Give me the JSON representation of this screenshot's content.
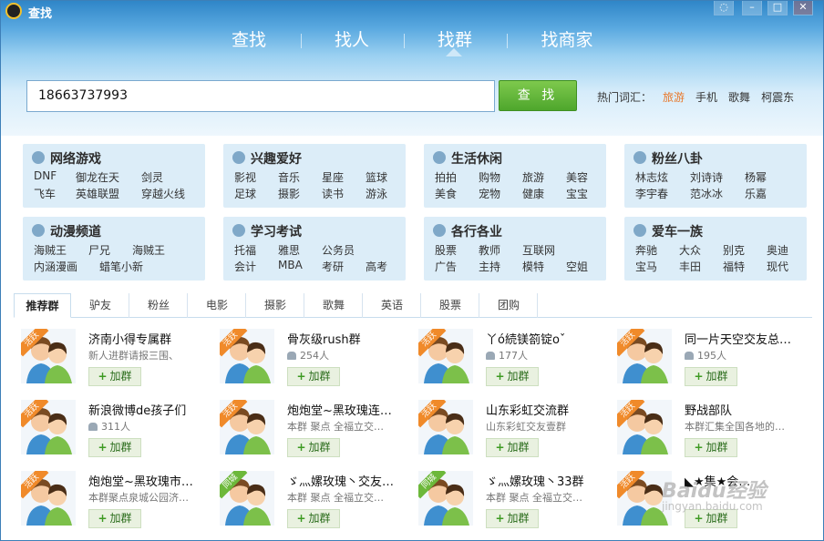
{
  "window": {
    "title": "查找",
    "controls": [
      "chat-icon",
      "minimize-icon",
      "maximize-icon",
      "close-icon"
    ]
  },
  "tabs": [
    {
      "label": "查找"
    },
    {
      "label": "找人"
    },
    {
      "label": "找群"
    },
    {
      "label": "找商家"
    }
  ],
  "active_tab": "找群",
  "search": {
    "value": "18663737993",
    "button_label": "查 找"
  },
  "hot": {
    "label": "热门词汇：",
    "words": [
      "旅游",
      "手机",
      "歌舞",
      "柯震东"
    ]
  },
  "categories": [
    {
      "title": "网络游戏",
      "icon": "pacman-icon",
      "links": [
        "DNF",
        "御龙在天",
        "剑灵",
        "飞车",
        "英雄联盟",
        "穿越火线"
      ]
    },
    {
      "title": "兴趣爱好",
      "icon": "palette-icon",
      "links": [
        "影视",
        "音乐",
        "星座",
        "篮球",
        "足球",
        "摄影",
        "读书",
        "游泳"
      ]
    },
    {
      "title": "生活休闲",
      "icon": "glasses-icon",
      "links": [
        "拍拍",
        "购物",
        "旅游",
        "美容",
        "美食",
        "宠物",
        "健康",
        "宝宝"
      ]
    },
    {
      "title": "粉丝八卦",
      "icon": "star-icon",
      "links": [
        "林志炫",
        "刘诗诗",
        "杨幂",
        "李宇春",
        "范冰冰",
        "乐嘉"
      ]
    },
    {
      "title": "动漫频道",
      "icon": "people-icon",
      "links": [
        "海贼王",
        "尸兄",
        "海贼王",
        "内涵漫画",
        "蜡笔小新"
      ]
    },
    {
      "title": "学习考试",
      "icon": "graduation-cap-icon",
      "links": [
        "托福",
        "雅思",
        "公务员",
        "会计",
        "MBA",
        "考研",
        "高考"
      ]
    },
    {
      "title": "各行各业",
      "icon": "briefcase-icon",
      "links": [
        "股票",
        "教师",
        "互联网",
        "广告",
        "主持",
        "模特",
        "空姐"
      ]
    },
    {
      "title": "爱车一族",
      "icon": "trophy-icon",
      "links": [
        "奔驰",
        "大众",
        "别克",
        "奥迪",
        "宝马",
        "丰田",
        "福特",
        "现代"
      ]
    }
  ],
  "subtabs": [
    "推荐群",
    "驴友",
    "粉丝",
    "电影",
    "摄影",
    "歌舞",
    "英语",
    "股票",
    "团购"
  ],
  "groups": [
    {
      "name": "济南小得专属群",
      "sub": "新人进群请报三围、",
      "badge": "活跃",
      "join": "加群"
    },
    {
      "name": "骨灰级rush群",
      "sub": "254人",
      "badge": "活跃",
      "join": "加群"
    },
    {
      "name": "丫ó続镁箚锭oˇ",
      "sub": "177人",
      "badge": "活跃",
      "join": "加群"
    },
    {
      "name": "同一片天空交友总…",
      "sub": "195人",
      "badge": "活跃",
      "join": "加群"
    },
    {
      "name": "新浪微博de孩子们",
      "sub": "311人",
      "badge": "活跃",
      "join": "加群"
    },
    {
      "name": "炮炮堂~黑玫瑰连…",
      "sub": "本群 聚点 全福立交…",
      "badge": "活跃",
      "join": "加群"
    },
    {
      "name": "山东彩虹交流群",
      "sub": "山东彩虹交友壹群",
      "badge": "活跃",
      "join": "加群"
    },
    {
      "name": "野战部队",
      "sub": "本群汇集全国各地的…",
      "badge": "活跃",
      "join": "加群"
    },
    {
      "name": "炮炮堂~黑玫瑰市…",
      "sub": "本群聚点泉城公园济…",
      "badge": "活跃",
      "join": "加群"
    },
    {
      "name": "ゞ灬嫘玫瑰丶交友…",
      "sub": "本群 聚点 全福立交…",
      "badge": "同城",
      "join": "加群"
    },
    {
      "name": "ゞ灬嫘玫瑰丶33群",
      "sub": "本群 聚点 全福立交…",
      "badge": "同城",
      "join": "加群"
    },
    {
      "name": "◣★集★会…",
      "sub": "",
      "badge": "活跃",
      "join": "加群"
    }
  ],
  "watermark": {
    "main": "Baidu经验",
    "sub": "jingyan.baidu.com"
  }
}
